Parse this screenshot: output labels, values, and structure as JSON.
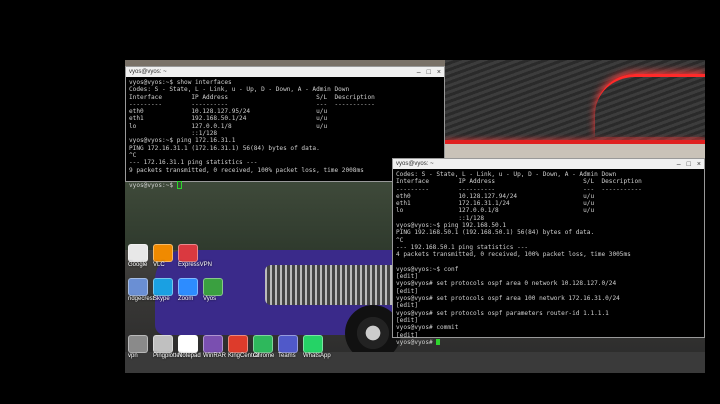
{
  "window1": {
    "title": "vyos@vyos: ~",
    "lines": [
      "vyos@vyos:~$ show interfaces",
      "Codes: S - State, L - Link, u - Up, D - Down, A - Admin Down",
      "Interface        IP Address                        S/L  Description",
      "---------        ----------                        ---  -----------",
      "eth0             10.128.127.95/24                  u/u",
      "eth1             192.168.50.1/24                   u/u",
      "lo               127.0.0.1/8                       u/u",
      "                 ::1/128",
      "vyos@vyos:~$ ping 172.16.31.1",
      "PING 172.16.31.1 (172.16.31.1) 56(84) bytes of data.",
      "^C",
      "--- 172.16.31.1 ping statistics ---",
      "9 packets transmitted, 0 received, 100% packet loss, time 2008ms",
      "",
      "vyos@vyos:~$ "
    ]
  },
  "window2": {
    "title": "vyos@vyos: ~",
    "lines": [
      "Codes: S - State, L - Link, u - Up, D - Down, A - Admin Down",
      "Interface        IP Address                        S/L  Description",
      "---------        ----------                        ---  -----------",
      "eth0             10.128.127.94/24                  u/u",
      "eth1             172.16.31.1/24                    u/u",
      "lo               127.0.0.1/8                       u/u",
      "                 ::1/128",
      "vyos@vyos:~$ ping 192.168.50.1",
      "PING 192.168.50.1 (192.168.50.1) 56(84) bytes of data.",
      "^C",
      "--- 192.168.50.1 ping statistics ---",
      "4 packets transmitted, 0 received, 100% packet loss, time 3005ms",
      "",
      "vyos@vyos:~$ conf",
      "[edit]",
      "vyos@vyos# set protocols ospf area 0 network 10.128.127.0/24",
      "[edit]",
      "vyos@vyos# set protocols ospf area 100 network 172.16.31.0/24",
      "[edit]",
      "vyos@vyos# set protocols ospf parameters router-id 1.1.1.1",
      "[edit]",
      "vyos@vyos# commit",
      "[edit]",
      "vyos@vyos# "
    ]
  },
  "desktop_icons": [
    {
      "label": "Google",
      "color": "#e8e8e8"
    },
    {
      "label": "VLC",
      "color": "#f08a00"
    },
    {
      "label": "ExpressVPN",
      "color": "#da3940"
    },
    {
      "label": "ridgecrest",
      "color": "#6a8fd4"
    },
    {
      "label": "Skype",
      "color": "#1aa0e2"
    },
    {
      "label": "Zoom",
      "color": "#2d8cff"
    },
    {
      "label": "Vyos",
      "color": "#3aa040"
    },
    {
      "label": "vpn",
      "color": "#8a8a8a"
    },
    {
      "label": "Pingplotter",
      "color": "#c0c0c0"
    },
    {
      "label": "Notepad",
      "color": "#ffffff"
    },
    {
      "label": "WinRAR",
      "color": "#7a4fb0"
    },
    {
      "label": "KingCentral",
      "color": "#dd3b2b"
    },
    {
      "label": "Chrome",
      "color": "#2eb85c"
    },
    {
      "label": "Teams",
      "color": "#5059c9"
    },
    {
      "label": "WhatsApp",
      "color": "#25d366"
    }
  ]
}
